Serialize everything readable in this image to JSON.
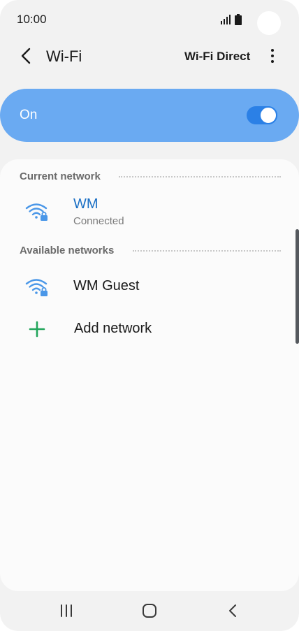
{
  "status_bar": {
    "time": "10:00",
    "icons": [
      "signal-icon",
      "battery-icon"
    ]
  },
  "app_bar": {
    "title": "Wi-Fi",
    "wifi_direct_label": "Wi-Fi Direct",
    "icons": [
      "back-arrow-icon",
      "more-options-icon"
    ]
  },
  "wifi_toggle": {
    "label": "On",
    "enabled": true
  },
  "current_network": {
    "header": "Current network",
    "name": "WM",
    "status": "Connected",
    "icon": "wifi-lock-icon"
  },
  "available_networks": {
    "header": "Available networks",
    "items": [
      {
        "name": "WM Guest",
        "icon": "wifi-lock-icon"
      }
    ]
  },
  "add_network": {
    "label": "Add network",
    "icon": "plus-icon"
  },
  "nav_bar": {
    "icons": [
      "recents-icon",
      "home-icon",
      "back-icon"
    ]
  },
  "colors": {
    "toggle_card": "#6aaaf2",
    "switch_track": "#2b80e6",
    "wifi_icon": "#4a97e8",
    "current_network_name": "#1a6fc4",
    "add_icon": "#22a55b",
    "page_bg": "#f2f2f2",
    "card_bg": "#fbfbfb"
  }
}
